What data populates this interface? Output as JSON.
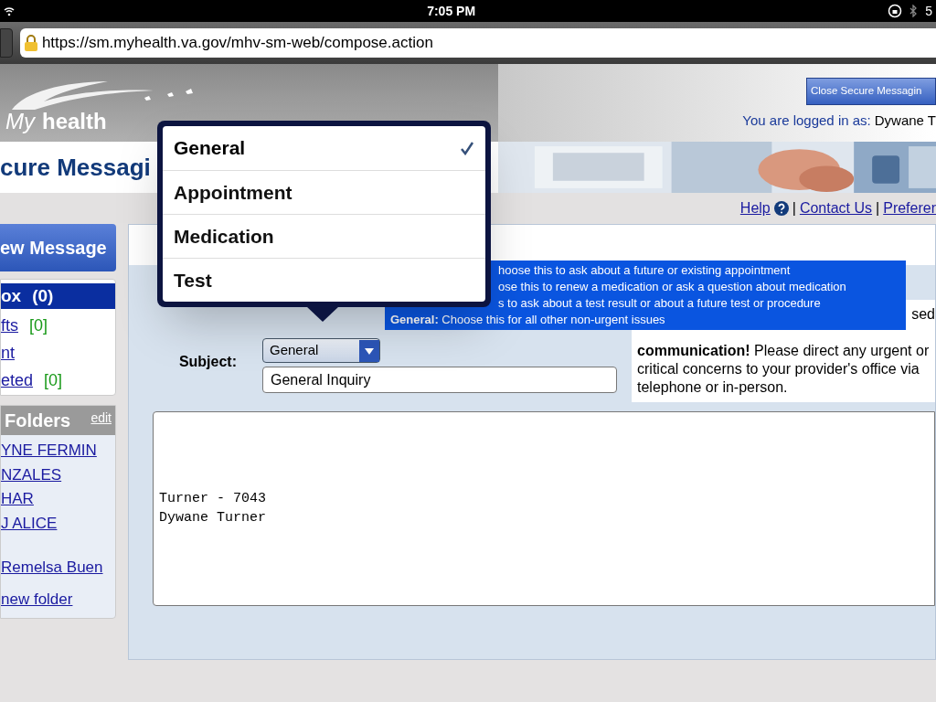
{
  "status_bar": {
    "time": "7:05 PM",
    "battery": "5"
  },
  "browser": {
    "url": "https://sm.myhealth.va.gov/mhv-sm-web/compose.action"
  },
  "header": {
    "logo_my": "My",
    "logo": "health",
    "close_button": "Close Secure Messagin",
    "logged_in_label": "You are logged in as:",
    "user": "Dywane T"
  },
  "title": "cure Messagi",
  "top_links": [
    "Help",
    "Contact Us",
    "Preferer"
  ],
  "link_separator": "|",
  "sidebar": {
    "new_message": "ew Message",
    "mailboxes": [
      {
        "label": "ox",
        "count": "(0)",
        "selected": true
      },
      {
        "label": "fts",
        "count": "[0]",
        "selected": false
      },
      {
        "label": "nt",
        "selected": false
      },
      {
        "label": "eted",
        "count": "[0]",
        "selected": false
      }
    ],
    "folders_title": "Folders",
    "edit": "edit",
    "folders": [
      "YNE FERMIN",
      "NZALES",
      "HAR",
      "J ALICE",
      "Remelsa Buen"
    ],
    "new_folder": "new folder"
  },
  "compose": {
    "subject_label": "Subject:",
    "category": "General",
    "subject": "General Inquiry",
    "disclaimer_visible": "sed",
    "disclaimer": "**communication!** Please direct any urgent or critical concerns to your provider's office via telephone or in-person.",
    "body": [
      "Turner - 7043",
      "Dywane Turner"
    ]
  },
  "tooltip": [
    "hoose this to ask about a future or existing appointment",
    "ose this to renew a medication or ask a question about medication",
    "s to ask about a test result or about a future test or procedure",
    "**General:** Choose this for all other non-urgent issues"
  ],
  "picker": [
    {
      "label": "General",
      "selected": true
    },
    {
      "label": "Appointment",
      "selected": false
    },
    {
      "label": "Medication",
      "selected": false
    },
    {
      "label": "Test",
      "selected": false
    }
  ]
}
